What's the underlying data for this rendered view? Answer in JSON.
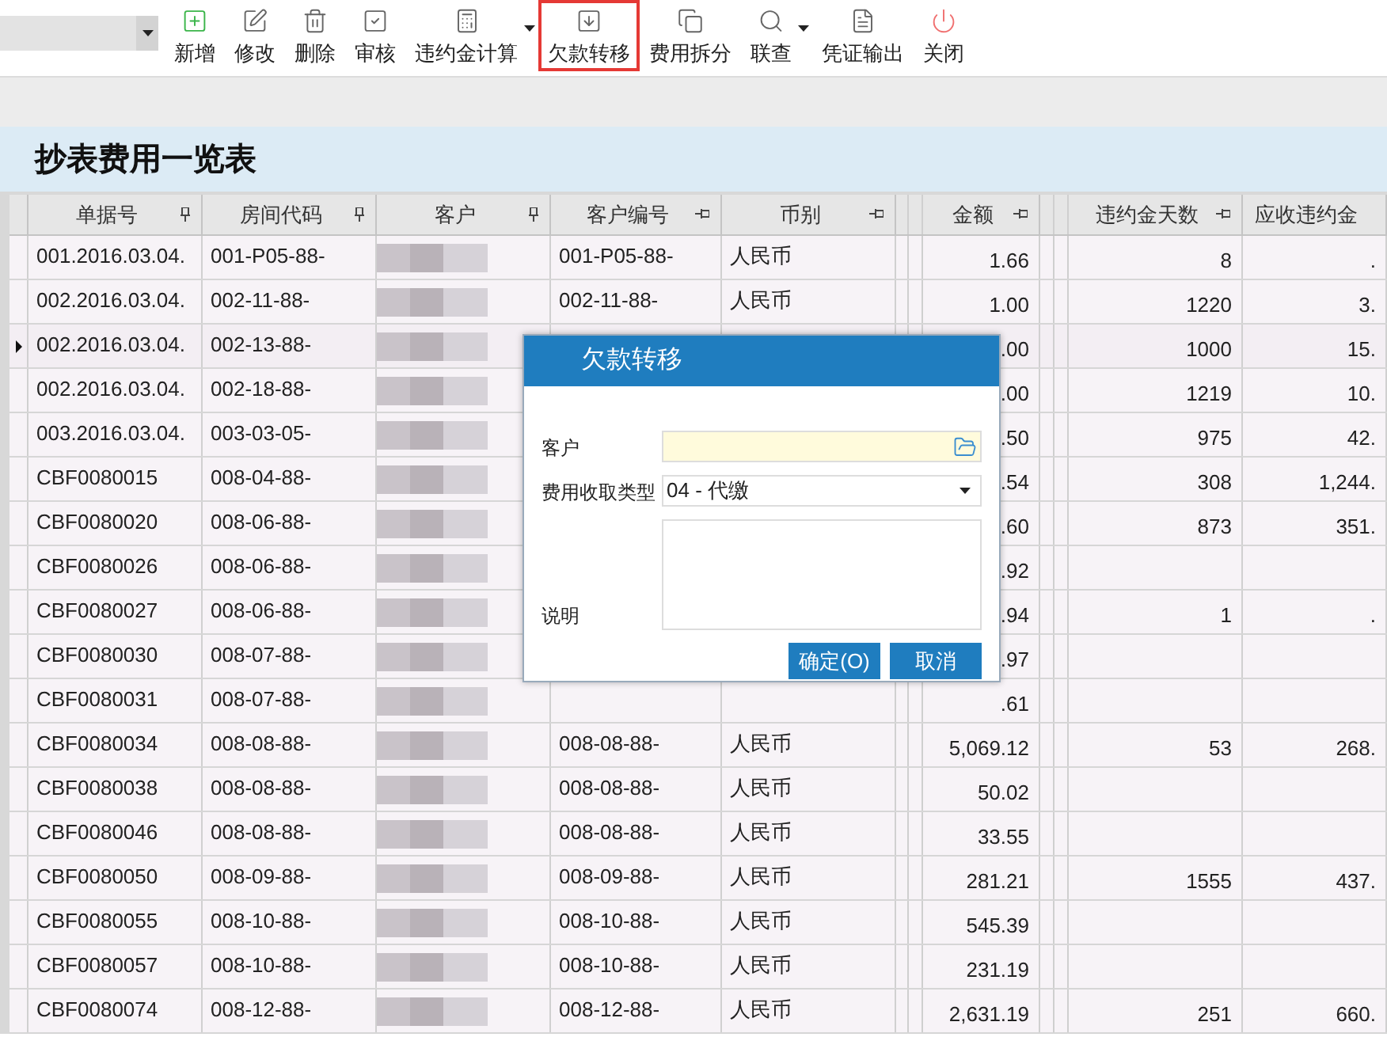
{
  "toolbar": {
    "tools": [
      {
        "label": "新增",
        "kind": "add",
        "dropdown": false,
        "highlighted": false
      },
      {
        "label": "修改",
        "kind": "edit",
        "dropdown": false,
        "highlighted": false
      },
      {
        "label": "删除",
        "kind": "delete",
        "dropdown": false,
        "highlighted": false
      },
      {
        "label": "审核",
        "kind": "approve",
        "dropdown": false,
        "highlighted": false
      },
      {
        "label": "违约金计算",
        "kind": "calculator",
        "dropdown": true,
        "highlighted": false
      },
      {
        "label": "欠款转移",
        "kind": "transfer",
        "dropdown": false,
        "highlighted": true
      },
      {
        "label": "费用拆分",
        "kind": "split",
        "dropdown": false,
        "highlighted": false
      },
      {
        "label": "联查",
        "kind": "search",
        "dropdown": true,
        "highlighted": false
      },
      {
        "label": "凭证输出",
        "kind": "document",
        "dropdown": false,
        "highlighted": false
      },
      {
        "label": "关闭",
        "kind": "power",
        "dropdown": false,
        "highlighted": false
      }
    ]
  },
  "title": "抄表费用一览表",
  "table": {
    "columns": [
      {
        "label": "单据号",
        "kind": "vertical"
      },
      {
        "label": "房间代码",
        "kind": "vertical"
      },
      {
        "label": "客户",
        "kind": "vertical"
      },
      {
        "label": "客户编号",
        "kind": "horizontal"
      },
      {
        "label": "币别",
        "kind": "horizontal"
      },
      {
        "label": "金额",
        "kind": "horizontal"
      },
      {
        "label": "违约金天数",
        "kind": "horizontal"
      },
      {
        "label": "应收违约金",
        "kind": "plain"
      }
    ],
    "rows": [
      {
        "bill_no": "001.2016.03.04.",
        "room": "001-P05-88-",
        "cust_no": "001-P05-88-",
        "currency": "人民币",
        "amount": "1.66",
        "days": "8",
        "penalty": ".",
        "selected": false
      },
      {
        "bill_no": "002.2016.03.04.",
        "room": "002-11-88-",
        "cust_no": "002-11-88-",
        "currency": "人民币",
        "amount": "1.00",
        "days": "1220",
        "penalty": "3.",
        "selected": false
      },
      {
        "bill_no": "002.2016.03.04.",
        "room": "002-13-88-",
        "amount": ".00",
        "days": "1000",
        "penalty": "15.",
        "selected": true
      },
      {
        "bill_no": "002.2016.03.04.",
        "room": "002-18-88-",
        "amount": ".00",
        "days": "1219",
        "penalty": "10.",
        "selected": false
      },
      {
        "bill_no": "003.2016.03.04.",
        "room": "003-03-05-",
        "amount": ".50",
        "days": "975",
        "penalty": "42.",
        "selected": false
      },
      {
        "bill_no": "CBF0080015",
        "room": "008-04-88-",
        "amount": ".54",
        "days": "308",
        "penalty": "1,244.",
        "selected": false
      },
      {
        "bill_no": "CBF0080020",
        "room": "008-06-88-",
        "amount": ".60",
        "days": "873",
        "penalty": "351.",
        "selected": false
      },
      {
        "bill_no": "CBF0080026",
        "room": "008-06-88-",
        "amount": ".92",
        "selected": false
      },
      {
        "bill_no": "CBF0080027",
        "room": "008-06-88-",
        "amount": ".94",
        "days": "1",
        "penalty": ".",
        "selected": false
      },
      {
        "bill_no": "CBF0080030",
        "room": "008-07-88-",
        "amount": ".97",
        "selected": false
      },
      {
        "bill_no": "CBF0080031",
        "room": "008-07-88-",
        "amount": ".61",
        "selected": false
      },
      {
        "bill_no": "CBF0080034",
        "room": "008-08-88-",
        "cust_no": "008-08-88-",
        "currency": "人民币",
        "amount": "5,069.12",
        "days": "53",
        "penalty": "268.",
        "selected": false
      },
      {
        "bill_no": "CBF0080038",
        "room": "008-08-88-",
        "cust_no": "008-08-88-",
        "currency": "人民币",
        "amount": "50.02",
        "selected": false
      },
      {
        "bill_no": "CBF0080046",
        "room": "008-08-88-",
        "cust_no": "008-08-88-",
        "currency": "人民币",
        "amount": "33.55",
        "selected": false
      },
      {
        "bill_no": "CBF0080050",
        "room": "008-09-88-",
        "cust_no": "008-09-88-",
        "currency": "人民币",
        "amount": "281.21",
        "days": "1555",
        "penalty": "437.",
        "selected": false
      },
      {
        "bill_no": "CBF0080055",
        "room": "008-10-88-",
        "cust_no": "008-10-88-",
        "currency": "人民币",
        "amount": "545.39",
        "selected": false
      },
      {
        "bill_no": "CBF0080057",
        "room": "008-10-88-",
        "cust_no": "008-10-88-",
        "currency": "人民币",
        "amount": "231.19",
        "selected": false
      },
      {
        "bill_no": "CBF0080074",
        "room": "008-12-88-",
        "cust_no": "008-12-88-",
        "currency": "人民币",
        "amount": "2,631.19",
        "days": "251",
        "penalty": "660.",
        "selected": false
      }
    ]
  },
  "dialog": {
    "title": "欠款转移",
    "fields": [
      {
        "label": "客户",
        "kind": "lookup"
      },
      {
        "label": "费用收取类型",
        "kind": "select",
        "value": "04 - 代缴"
      },
      {
        "label": "说明",
        "kind": "textarea"
      }
    ],
    "buttons": [
      "确定(O)",
      "取消"
    ]
  }
}
